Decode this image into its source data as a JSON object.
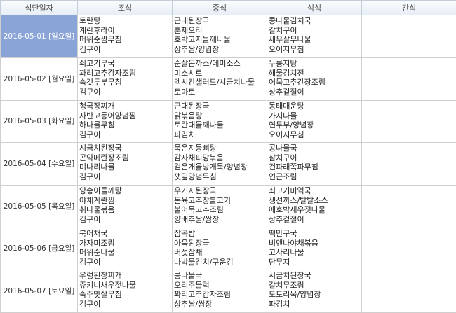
{
  "headers": [
    "식단일자",
    "조식",
    "중식",
    "석식",
    "간식"
  ],
  "rows": [
    {
      "date": "2016-05-01 [일요일]",
      "breakfast": [
        "토란탕",
        "계란후라이",
        "머위순쌈무침",
        "김구이"
      ],
      "lunch": [
        "근대된장국",
        "훈제오리",
        "호박고지들깨나물",
        "상추쌈/양념장"
      ],
      "dinner": [
        "콩나물김치국",
        "갈치구이",
        "새우살무나물",
        "오이지무침"
      ],
      "snack": []
    },
    {
      "date": "2016-05-02 [월요일]",
      "breakfast": [
        "쇠고기무국",
        "꽈리고추감자조림",
        "숙갓두부무침",
        "김구이"
      ],
      "lunch": [
        "순살돈까스/데미소스",
        "미소시로",
        "멕시칸샐러드/시금치나물",
        "토마토"
      ],
      "dinner": [
        "누룽지탕",
        "해물김치전",
        "어묵고추간장조림",
        "상추겉절이"
      ],
      "snack": []
    },
    {
      "date": "2016-05-03 [화요일]",
      "breakfast": [
        "청국장찌개",
        "자반고등어양념찜",
        "하나물무침",
        "김구이"
      ],
      "lunch": [
        "근대된장국",
        "닭볶음탕",
        "토란대들깨나물",
        "파김치"
      ],
      "dinner": [
        "동태매운탕",
        "가지나물",
        "연두부/양념장",
        "오이지무침"
      ],
      "snack": []
    },
    {
      "date": "2016-05-04 [수요일]",
      "breakfast": [
        "시금치된장국",
        "곤약메란장조림",
        "미나리나물",
        "김구이"
      ],
      "lunch": [
        "묵은지등뼈탕",
        "감자채피망볶음",
        "검은개울방개묵/양념장",
        "깻잎양념무침"
      ],
      "dinner": [
        "콩나물국",
        "삼치구이",
        "건파래쪽파무침",
        "연근조림"
      ],
      "snack": []
    },
    {
      "date": "2016-05-05 [목요일]",
      "breakfast": [
        "양송이들깨탕",
        "야채계란찜",
        "취나물볶음",
        "김구이"
      ],
      "lunch": [
        "우거지된장국",
        "돈육고추장불고기",
        "불어묵고추조림",
        "양배추쌈/쌈장"
      ],
      "dinner": [
        "쇠고기미역국",
        "생선까스/탈탈소스",
        "애호박새우젓나물",
        "상추겉절이"
      ],
      "snack": []
    },
    {
      "date": "2016-05-06 [금요일]",
      "breakfast": [
        "북어채국",
        "가자미조림",
        "머위순나물",
        "김구이"
      ],
      "lunch": [
        "잡곡밥",
        "아욱된장국",
        "버섯잡채",
        "나박물김치/구운김"
      ],
      "dinner": [
        "떡만구국",
        "비엔나야채볶음",
        "고사리나물",
        "단무지"
      ],
      "snack": []
    },
    {
      "date": "2016-05-07 [토요일]",
      "breakfast": [
        "우렁된장찌개",
        "쥬키니새우젓나물",
        "숙주맛살무침",
        "김구이"
      ],
      "lunch": [
        "콩나물국",
        "오리주물럭",
        "꽈리고추감자조림",
        "상추쌈/쌈장"
      ],
      "dinner": [
        "시금치된장국",
        "갈치무조림",
        "도토리묵/양념장",
        "파김치"
      ],
      "snack": []
    }
  ],
  "selected_row": 0,
  "colors": {
    "header_bg": "#e6edf4",
    "selected_bg": "#8ba4d8",
    "border": "#cfcfcf"
  }
}
